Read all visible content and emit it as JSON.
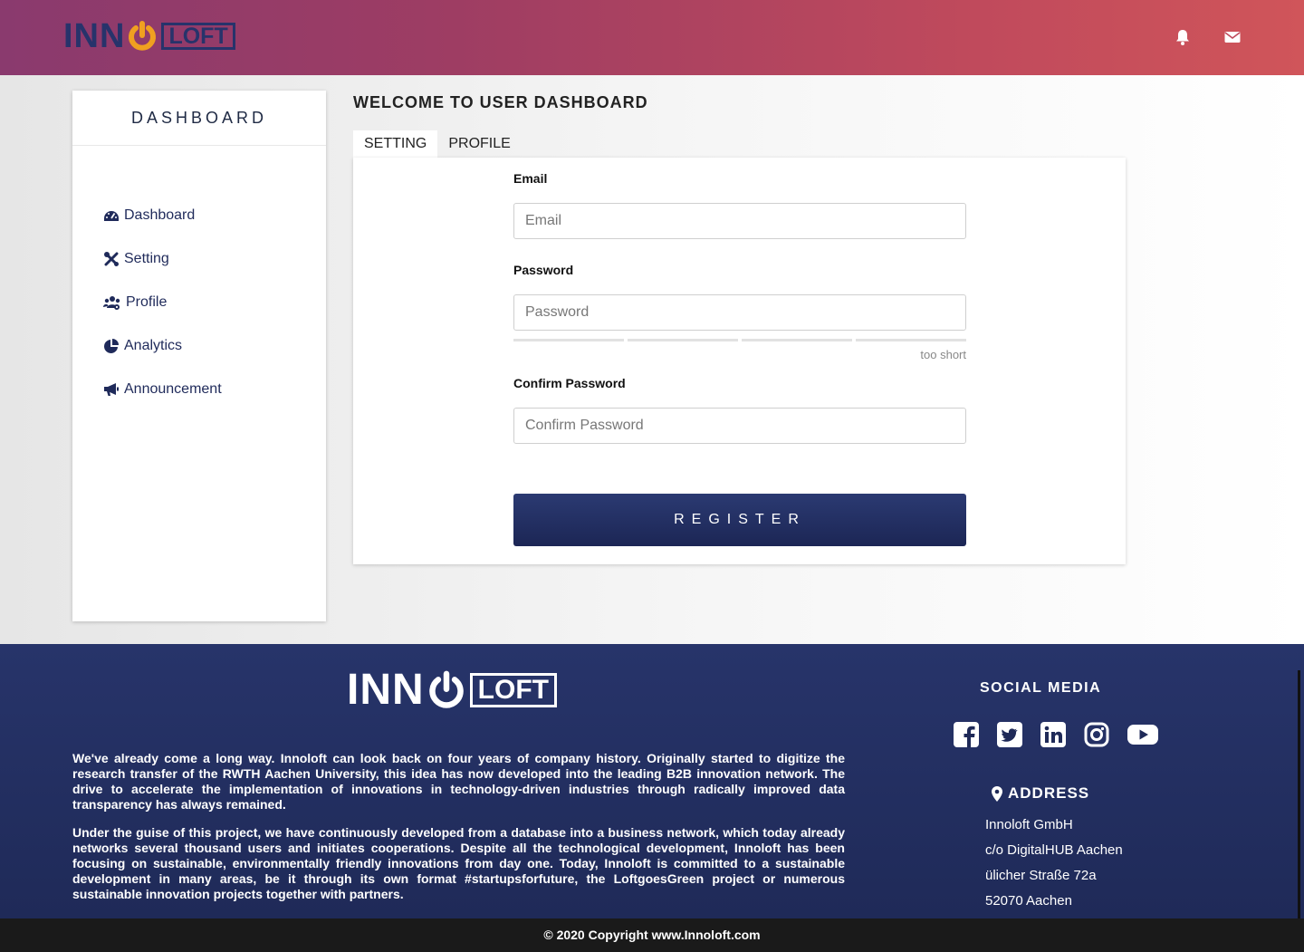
{
  "header": {
    "logo_left": "INN",
    "logo_right": "LOFT",
    "icons": [
      "bell-icon",
      "envelope-icon"
    ]
  },
  "sidebar": {
    "title": "DASHBOARD",
    "items": [
      {
        "label": "Dashboard",
        "icon": "tachometer-icon"
      },
      {
        "label": "Setting",
        "icon": "tools-icon"
      },
      {
        "label": "Profile",
        "icon": "users-cog-icon"
      },
      {
        "label": "Analytics",
        "icon": "pie-chart-icon"
      },
      {
        "label": "Announcement",
        "icon": "bullhorn-icon"
      }
    ]
  },
  "main": {
    "title": "WELCOME TO USER DASHBOARD",
    "tabs": [
      {
        "label": "SETTING",
        "active": true
      },
      {
        "label": "PROFILE",
        "active": false
      }
    ],
    "form": {
      "email_label": "Email",
      "email_placeholder": "Email",
      "password_label": "Password",
      "password_placeholder": "Password",
      "strength_text": "too short",
      "confirm_label": "Confirm Password",
      "confirm_placeholder": "Confirm Password",
      "register_label": "REGISTER"
    }
  },
  "footer": {
    "logo_left": "INN",
    "logo_right": "LOFT",
    "about_1": "We've already come a long way. Innoloft can look back on four years of company history. Originally started to digitize the research transfer of the RWTH Aachen University, this idea has now developed into the leading B2B innovation network. The drive to accelerate the implementation of innovations in technology-driven industries through radically improved data transparency has always remained.",
    "about_2": "Under the guise of this project, we have continuously developed from a database into a business network, which today already networks several thousand users and initiates cooperations. Despite all the technological development, Innoloft has been focusing on sustainable, environmentally friendly innovations from day one. Today, Innoloft is committed to a sustainable development in many areas, be it through its own format #startupsforfuture, the LoftgoesGreen project or numerous sustainable innovation projects together with partners.",
    "social_title": "SOCIAL MEDIA",
    "social_icons": [
      "facebook-icon",
      "twitter-icon",
      "linkedin-icon",
      "instagram-icon",
      "youtube-icon"
    ],
    "address_title": "ADDRESS",
    "address_lines": [
      "Innoloft GmbH",
      "c/o DigitalHUB Aachen",
      "ülicher Straße 72a",
      "52070 Aachen"
    ],
    "copyright": "© 2020 Copyright www.Innoloft.com"
  },
  "colors": {
    "brand_navy": "#1f2a58",
    "accent_orange": "#f0a020",
    "header_gradient_start": "#8a3a6e",
    "header_gradient_end": "#d0555a"
  }
}
